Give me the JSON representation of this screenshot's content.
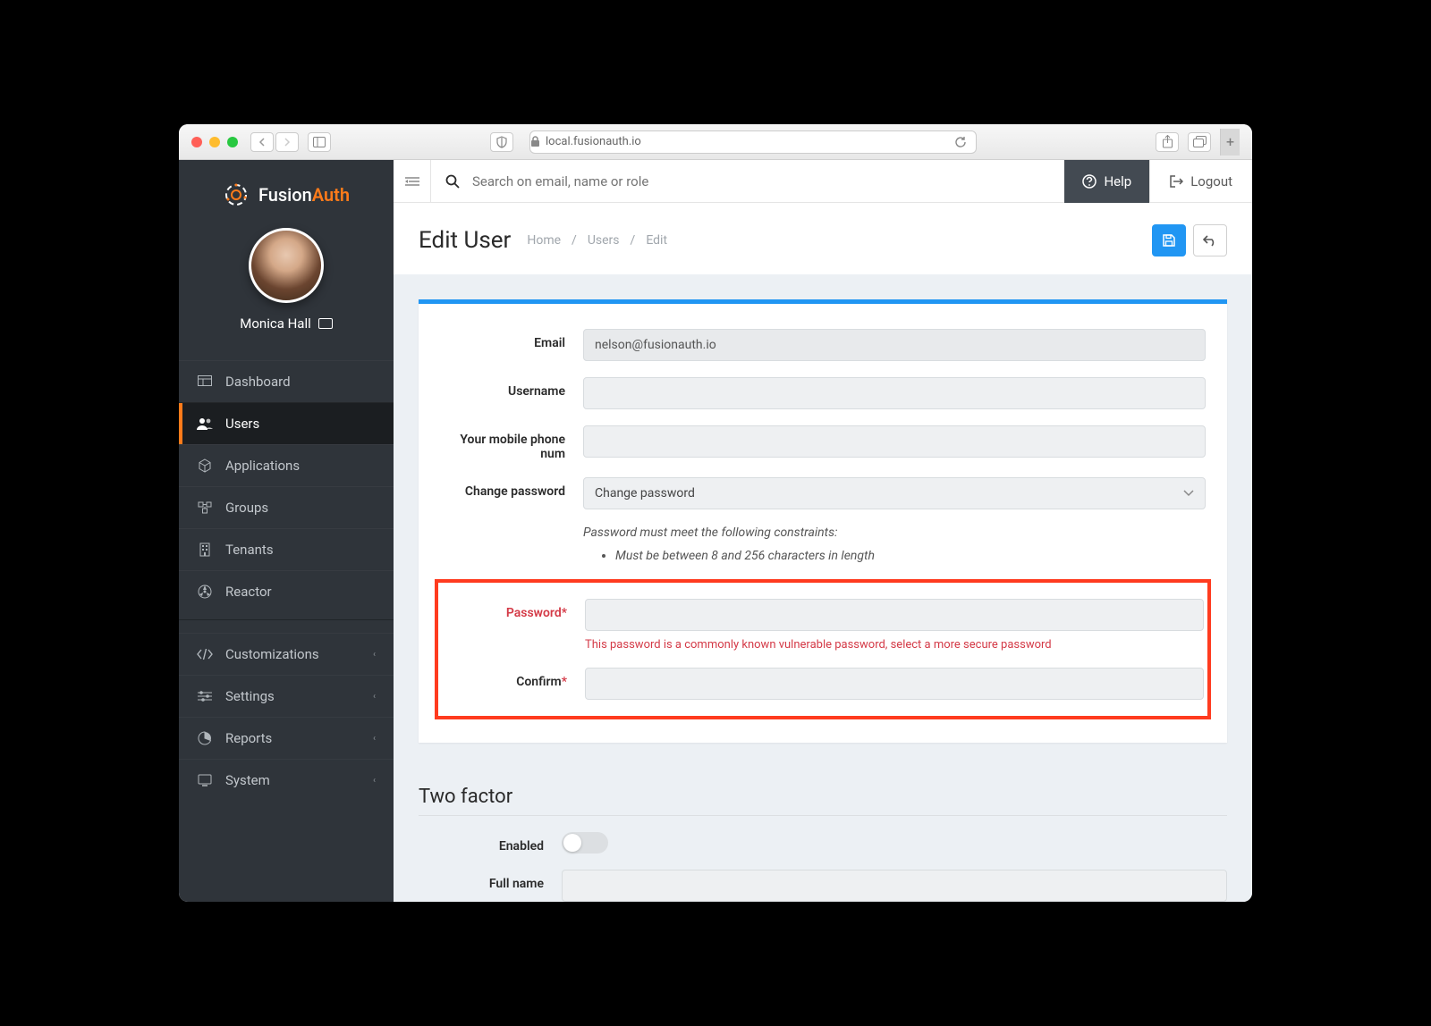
{
  "browser": {
    "url": "local.fusionauth.io"
  },
  "brand": {
    "name_prefix": "Fusion",
    "name_suffix": "Auth"
  },
  "user": {
    "display_name": "Monica Hall"
  },
  "sidebar": {
    "items": [
      {
        "label": "Dashboard"
      },
      {
        "label": "Users"
      },
      {
        "label": "Applications"
      },
      {
        "label": "Groups"
      },
      {
        "label": "Tenants"
      },
      {
        "label": "Reactor"
      },
      {
        "label": "Customizations"
      },
      {
        "label": "Settings"
      },
      {
        "label": "Reports"
      },
      {
        "label": "System"
      }
    ]
  },
  "topbar": {
    "search_placeholder": "Search on email, name or role",
    "help_label": "Help",
    "logout_label": "Logout"
  },
  "page": {
    "title": "Edit User",
    "breadcrumb": {
      "home": "Home",
      "users": "Users",
      "edit": "Edit"
    }
  },
  "form": {
    "email_label": "Email",
    "email_value": "nelson@fusionauth.io",
    "username_label": "Username",
    "username_value": "",
    "phone_label": "Your mobile phone num",
    "phone_value": "",
    "change_password_label": "Change password",
    "change_password_value": "Change password",
    "constraints_heading": "Password must meet the following constraints:",
    "constraints": [
      "Must be between 8 and 256 characters in length"
    ],
    "password_label": "Password",
    "password_error": "This password is a commonly known vulnerable password, select a more secure password",
    "confirm_label": "Confirm",
    "two_factor_title": "Two factor",
    "enabled_label": "Enabled",
    "fullname_label": "Full name",
    "fullname_value": ""
  }
}
